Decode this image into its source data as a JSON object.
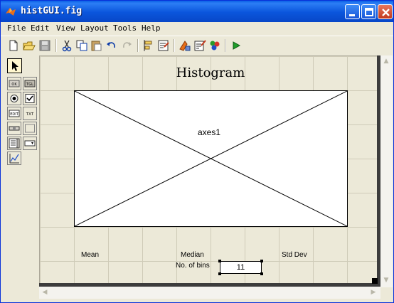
{
  "window": {
    "title": "histGUI.fig"
  },
  "menubar": [
    {
      "label": "File"
    },
    {
      "label": "Edit"
    },
    {
      "label": "View"
    },
    {
      "label": "Layout"
    },
    {
      "label": "Tools"
    },
    {
      "label": "Help"
    }
  ],
  "toolbar": {
    "buttons": [
      "new-icon",
      "open-icon",
      "save-icon",
      "cut-icon",
      "copy-icon",
      "paste-icon",
      "undo-icon",
      "redo-icon",
      "align-icon",
      "menu-editor-icon",
      "tab-order-icon",
      "mfile-editor-icon",
      "property-inspector-icon",
      "object-browser-icon",
      "run-icon"
    ]
  },
  "palette": {
    "tools": [
      "select-arrow",
      "push-button",
      "toggle-button",
      "radio-button",
      "checkbox",
      "edit-text",
      "static-text",
      "slider",
      "frame",
      "listbox",
      "popup-menu",
      "axes"
    ],
    "push_label": "OK",
    "toggle_label": "TGL",
    "edit_label": "EDIT",
    "static_label": "TXT"
  },
  "canvas": {
    "title": "Histogram",
    "axes_label": "axes1",
    "mean_label": "Mean",
    "median_label": "Median",
    "std_label": "Std Dev",
    "bins_label": "No. of bins",
    "bins_value": "11"
  },
  "colors": {
    "titlebar": "#0a55dc",
    "face": "#ece9d8",
    "grid": "#cfcbb8"
  }
}
